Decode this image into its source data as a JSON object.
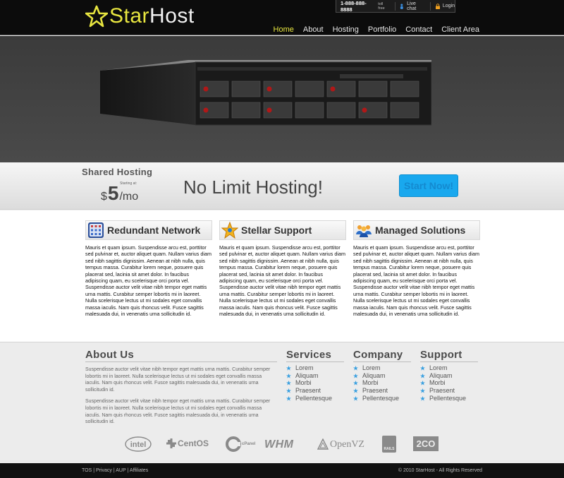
{
  "brand": {
    "logo_prefix": "Star",
    "logo_suffix": "Host",
    "accent_color": "#e8e640"
  },
  "topbar": {
    "phone": "1-888-888-8888",
    "toll_free": "toll free",
    "live_chat": "Live chat",
    "login": "Login"
  },
  "nav": {
    "items": [
      "Home",
      "About",
      "Hosting",
      "Portfolio",
      "Contact",
      "Client Area"
    ],
    "active": "Home"
  },
  "promo": {
    "plan_name": "Shared Hosting",
    "starting_at": "Starting at:",
    "currency": "$",
    "price": "5",
    "per": "/mo",
    "headline": "No Limit Hosting!",
    "cta_label": "Start Now!",
    "cta_color": "#19a8ee"
  },
  "features": [
    {
      "title": "Redundant Network",
      "icon": "network-grid-icon",
      "body": "Mauris et quam ipsum. Suspendisse arcu est, porttitor sed pulvinar et, auctor aliquet quam. Nullam varius diam sed nibh sagittis dignissim. Aenean at nibh nulla, quis tempus massa. Curabitur lorem neque, posuere quis placerat sed, lacinia sit amet dolor. In faucibus adipiscing quam, eu scelerisque orci porta vel. Suspendisse auctor velit vitae nibh tempor eget mattis urna mattis. Curabitur semper lobortis mi in laoreet. Nulla scelerisque lectus ut mi sodales eget convallis massa iaculis. Nam quis rhoncus velit. Fusce sagittis malesuada dui, in venenatis urna sollicitudin id."
    },
    {
      "title": "Stellar Support",
      "icon": "star-support-icon",
      "body": "Mauris et quam ipsum. Suspendisse arcu est, porttitor sed pulvinar et, auctor aliquet quam. Nullam varius diam sed nibh sagittis dignissim. Aenean at nibh nulla, quis tempus massa. Curabitur lorem neque, posuere quis placerat sed, lacinia sit amet dolor. In faucibus adipiscing quam, eu scelerisque orci porta vel. Suspendisse auctor velit vitae nibh tempor eget mattis urna mattis. Curabitur semper lobortis mi in laoreet. Nulla scelerisque lectus ut mi sodales eget convallis massa iaculis. Nam quis rhoncus velit. Fusce sagittis malesuada dui, in venenatis urna sollicitudin id."
    },
    {
      "title": "Managed Solutions",
      "icon": "users-group-icon",
      "body": "Mauris et quam ipsum. Suspendisse arcu est, porttitor sed pulvinar et, auctor aliquet quam. Nullam varius diam sed nibh sagittis dignissim. Aenean at nibh nulla, quis tempus massa. Curabitur lorem neque, posuere quis placerat sed, lacinia sit amet dolor. In faucibus adipiscing quam, eu scelerisque orci porta vel. Suspendisse auctor velit vitae nibh tempor eget mattis urna mattis. Curabitur semper lobortis mi in laoreet. Nulla scelerisque lectus ut mi sodales eget convallis massa iaculis. Nam quis rhoncus velit. Fusce sagittis malesuada dui, in venenatis urna sollicitudin id."
    }
  ],
  "about": {
    "title": "About Us",
    "paragraphs": [
      "Suspendisse auctor velit vitae nibh tempor eget mattis urna mattis. Curabitur semper lobortis mi in laoreet. Nulla scelerisque lectus ut mi sodales eget convallis massa iaculis. Nam quis rhoncus velit. Fusce sagittis malesuada dui, in venenatis urna sollicitudin id.",
      "Suspendisse auctor velit vitae nibh tempor eget mattis urna mattis. Curabitur semper lobortis mi in laoreet. Nulla scelerisque lectus ut mi sodales eget convallis massa iaculis. Nam quis rhoncus velit. Fusce sagittis malesuada dui, in venenatis urna sollicitudin id."
    ]
  },
  "link_columns": [
    {
      "title": "Services",
      "links": [
        "Lorem",
        "Aliquam",
        "Morbi",
        "Praesent",
        "Pellentesque"
      ]
    },
    {
      "title": "Company",
      "links": [
        "Lorem",
        "Aliquam",
        "Morbi",
        "Praesent",
        "Pellentesque"
      ]
    },
    {
      "title": "Support",
      "links": [
        "Lorem",
        "Aliquam",
        "Morbi",
        "Praesent",
        "Pellentesque"
      ]
    }
  ],
  "partners": [
    "intel",
    "CentOS",
    "cPanel",
    "WHM",
    "OpenVZ",
    "RAILS",
    "2CO"
  ],
  "footer": {
    "links": [
      "TOS",
      "Privacy",
      "AUP",
      "Affiliates"
    ],
    "copyright": "© 2010 StarHost - All Rights Reserved"
  }
}
